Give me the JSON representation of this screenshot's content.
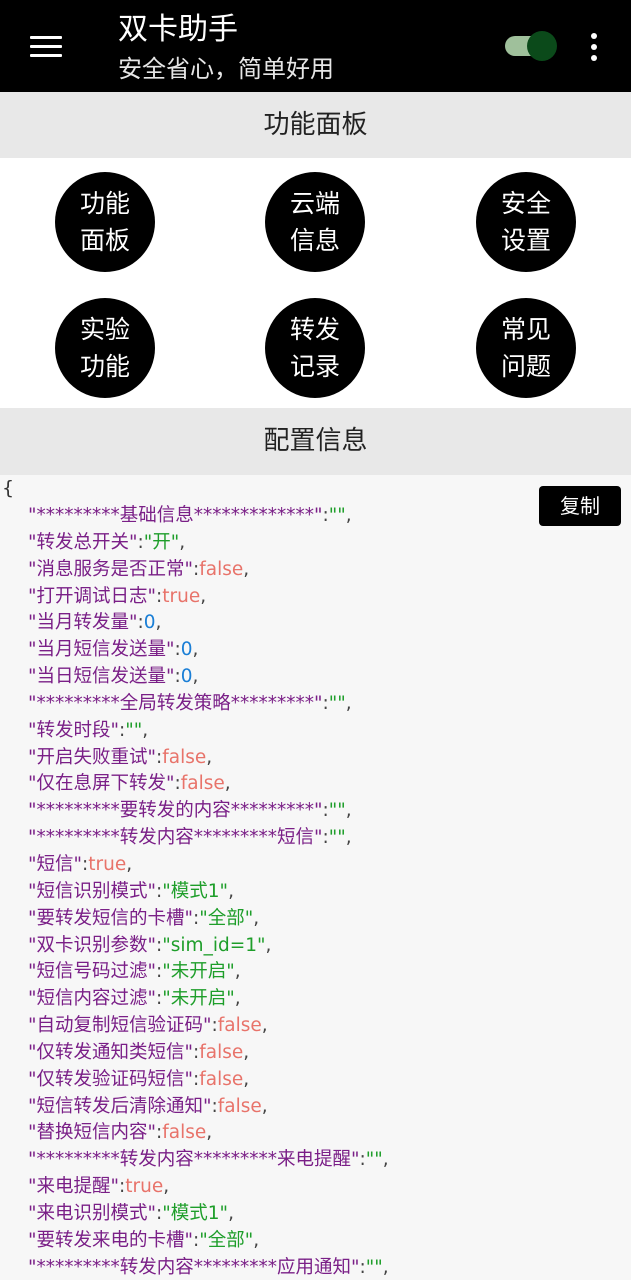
{
  "app_bar": {
    "title": "双卡助手",
    "subtitle": "安全省心，简单好用",
    "menu_icon": "hamburger-menu-icon",
    "toggle": {
      "on": true,
      "accent": "#0b4a1a"
    },
    "more_icon": "more-vertical-icon"
  },
  "function_panel": {
    "header": "功能面板",
    "buttons": [
      {
        "line1": "功能",
        "line2": "面板"
      },
      {
        "line1": "云端",
        "line2": "信息"
      },
      {
        "line1": "安全",
        "line2": "设置"
      },
      {
        "line1": "实验",
        "line2": "功能"
      },
      {
        "line1": "转发",
        "line2": "记录"
      },
      {
        "line1": "常见",
        "line2": "问题"
      }
    ]
  },
  "config": {
    "header": "配置信息",
    "copy_label": "复制",
    "open_brace": "{",
    "lines": [
      {
        "key": "\"*********基础信息*************\"",
        "value": "\"\"",
        "type": "s"
      },
      {
        "key": "\"转发总开关\"",
        "value": "\"开\"",
        "type": "s"
      },
      {
        "key": "\"消息服务是否正常\"",
        "value": "false",
        "type": "b"
      },
      {
        "key": "\"打开调试日志\"",
        "value": "true",
        "type": "b"
      },
      {
        "key": "\"当月转发量\"",
        "value": "0",
        "type": "n"
      },
      {
        "key": "\"当月短信发送量\"",
        "value": "0",
        "type": "n"
      },
      {
        "key": "\"当日短信发送量\"",
        "value": "0",
        "type": "n"
      },
      {
        "key": "\"*********全局转发策略*********\"",
        "value": "\"\"",
        "type": "s"
      },
      {
        "key": "\"转发时段\"",
        "value": "\"\"",
        "type": "s"
      },
      {
        "key": "\"开启失败重试\"",
        "value": "false",
        "type": "b"
      },
      {
        "key": "\"仅在息屏下转发\"",
        "value": "false",
        "type": "b"
      },
      {
        "key": "\"*********要转发的内容*********\"",
        "value": "\"\"",
        "type": "s"
      },
      {
        "key": "\"*********转发内容*********短信\"",
        "value": "\"\"",
        "type": "s"
      },
      {
        "key": "\"短信\"",
        "value": "true",
        "type": "b"
      },
      {
        "key": "\"短信识别模式\"",
        "value": "\"模式1\"",
        "type": "s"
      },
      {
        "key": "\"要转发短信的卡槽\"",
        "value": "\"全部\"",
        "type": "s"
      },
      {
        "key": "\"双卡识别参数\"",
        "value": "\"sim_id=1\"",
        "type": "s"
      },
      {
        "key": "\"短信号码过滤\"",
        "value": "\"未开启\"",
        "type": "s"
      },
      {
        "key": "\"短信内容过滤\"",
        "value": "\"未开启\"",
        "type": "s"
      },
      {
        "key": "\"自动复制短信验证码\"",
        "value": "false",
        "type": "b"
      },
      {
        "key": "\"仅转发通知类短信\"",
        "value": "false",
        "type": "b"
      },
      {
        "key": "\"仅转发验证码短信\"",
        "value": "false",
        "type": "b"
      },
      {
        "key": "\"短信转发后清除通知\"",
        "value": "false",
        "type": "b"
      },
      {
        "key": "\"替换短信内容\"",
        "value": "false",
        "type": "b"
      },
      {
        "key": "\"*********转发内容*********来电提醒\"",
        "value": "\"\"",
        "type": "s"
      },
      {
        "key": "\"来电提醒\"",
        "value": "true",
        "type": "b"
      },
      {
        "key": "\"来电识别模式\"",
        "value": "\"模式1\"",
        "type": "s"
      },
      {
        "key": "\"要转发来电的卡槽\"",
        "value": "\"全部\"",
        "type": "s"
      },
      {
        "key": "\"*********转发内容*********应用通知\"",
        "value": "\"\"",
        "type": "s"
      }
    ]
  },
  "colors": {
    "key": "#7a1f87",
    "string": "#1e9e2a",
    "boolean": "#e8736a",
    "number": "#1b7fd6"
  }
}
